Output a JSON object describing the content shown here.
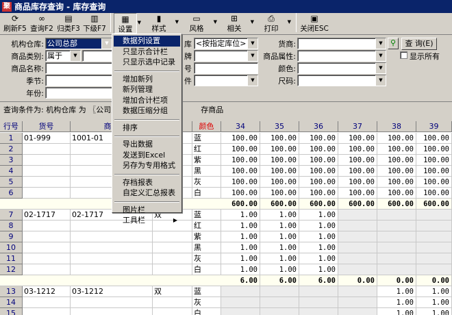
{
  "window": {
    "title": "商品库存查询 - 库存查询"
  },
  "toolbar": [
    {
      "label": "刷新F5",
      "icon": "refresh-icon"
    },
    {
      "label": "查询F2",
      "icon": "binoculars-icon"
    },
    {
      "label": "归类F3",
      "icon": "group-icon"
    },
    {
      "label": "下级F7",
      "icon": "subordinate-icon"
    },
    {
      "label": "设置",
      "icon": "settings-icon"
    },
    {
      "label": "样式",
      "icon": "style-icon"
    },
    {
      "label": "风格",
      "icon": "theme-icon"
    },
    {
      "label": "相关",
      "icon": "related-icon"
    },
    {
      "label": "打印",
      "icon": "printer-icon"
    },
    {
      "label": "关闭ESC",
      "icon": "close-icon"
    }
  ],
  "filters": {
    "warehouse_label": "机构仓库:",
    "warehouse_value": "公司总部",
    "category_label": "商品类别:",
    "category_op": "属于",
    "name_label": "商品名称:",
    "season_label": "季节:",
    "year_label": "年份:",
    "position_value": "<按指定库位>",
    "supplier_label": "货商:",
    "attr_label": "商品属性:",
    "color_label": "颜色:",
    "size_label": "尺码:",
    "query_button": "查 询(E)",
    "show_all_label": "显示所有",
    "partial_1": "库",
    "partial_2": "牌",
    "partial_3": "号",
    "partial_4": "件"
  },
  "condition": {
    "prefix": "查询条件为: 机构仓库 为 〖公司总",
    "suffix": "存商品"
  },
  "table": {
    "headers": {
      "rowno": "行号",
      "code": "货号",
      "name": "商品",
      "color": "颜色",
      "s34": "34",
      "s35": "35",
      "s36": "36",
      "s37": "37",
      "s38": "38",
      "s39": "39"
    },
    "rows": [
      {
        "no": "1",
        "code": "01-999",
        "name": "1001-01",
        "color": "蓝",
        "v": [
          "100.00",
          "100.00",
          "100.00",
          "100.00",
          "100.00",
          "100.00"
        ]
      },
      {
        "no": "2",
        "color": "红",
        "v": [
          "100.00",
          "100.00",
          "100.00",
          "100.00",
          "100.00",
          "100.00"
        ]
      },
      {
        "no": "3",
        "color": "紫",
        "v": [
          "100.00",
          "100.00",
          "100.00",
          "100.00",
          "100.00",
          "100.00"
        ]
      },
      {
        "no": "4",
        "color": "黑",
        "v": [
          "100.00",
          "100.00",
          "100.00",
          "100.00",
          "100.00",
          "100.00"
        ]
      },
      {
        "no": "5",
        "color": "灰",
        "v": [
          "100.00",
          "100.00",
          "100.00",
          "100.00",
          "100.00",
          "100.00"
        ]
      },
      {
        "no": "6",
        "color": "白",
        "v": [
          "100.00",
          "100.00",
          "100.00",
          "100.00",
          "100.00",
          "100.00"
        ]
      },
      {
        "subtotal": true,
        "v": [
          "600.00",
          "600.00",
          "600.00",
          "600.00",
          "600.00",
          "600.00"
        ]
      },
      {
        "no": "7",
        "code": "02-1717",
        "name": "02-1717",
        "extra": "双",
        "color": "蓝",
        "v": [
          "1.00",
          "1.00",
          "1.00",
          "",
          "",
          ""
        ]
      },
      {
        "no": "8",
        "color": "红",
        "v": [
          "1.00",
          "1.00",
          "1.00",
          "",
          "",
          ""
        ]
      },
      {
        "no": "9",
        "color": "紫",
        "v": [
          "1.00",
          "1.00",
          "1.00",
          "",
          "",
          ""
        ]
      },
      {
        "no": "10",
        "color": "黑",
        "v": [
          "1.00",
          "1.00",
          "1.00",
          "",
          "",
          ""
        ]
      },
      {
        "no": "11",
        "color": "灰",
        "v": [
          "1.00",
          "1.00",
          "1.00",
          "",
          "",
          ""
        ]
      },
      {
        "no": "12",
        "color": "白",
        "v": [
          "1.00",
          "1.00",
          "1.00",
          "",
          "",
          ""
        ]
      },
      {
        "subtotal": true,
        "v": [
          "6.00",
          "6.00",
          "6.00",
          "0.00",
          "0.00",
          "0.00"
        ]
      },
      {
        "no": "13",
        "code": "03-1212",
        "name": "03-1212",
        "extra": "双",
        "color": "蓝",
        "v": [
          "",
          "",
          "",
          "",
          "1.00",
          "1.00"
        ]
      },
      {
        "no": "14",
        "color": "灰",
        "v": [
          "",
          "",
          "",
          "",
          "1.00",
          "1.00"
        ]
      },
      {
        "no": "15",
        "color": "白",
        "v": [
          "",
          "",
          "",
          "",
          "1.00",
          "1.00"
        ]
      }
    ]
  },
  "menu": {
    "items": [
      {
        "label": "数据列设置",
        "highlight": true
      },
      {
        "label": "只显示合计栏"
      },
      {
        "label": "只显示选中记录"
      },
      {
        "sep": true
      },
      {
        "label": "增加新列"
      },
      {
        "label": "新列管理"
      },
      {
        "label": "增加合计栏项"
      },
      {
        "label": "数据压缩分组"
      },
      {
        "sep": true
      },
      {
        "label": "排序"
      },
      {
        "sep": true
      },
      {
        "label": "导出数据"
      },
      {
        "label": "发送到Excel"
      },
      {
        "label": "另存为专用格式"
      },
      {
        "sep": true
      },
      {
        "label": "存档报表"
      },
      {
        "label": "自定义汇总报表"
      },
      {
        "sep": true
      },
      {
        "label": "图片栏"
      },
      {
        "label": "工具栏",
        "submenu": true
      }
    ]
  }
}
